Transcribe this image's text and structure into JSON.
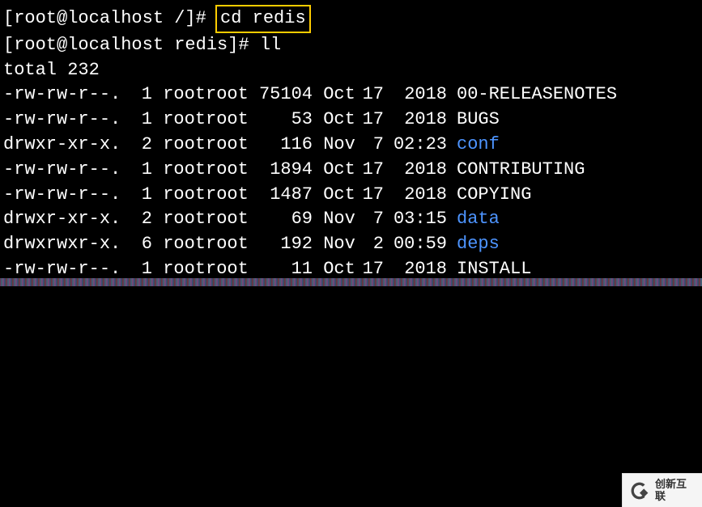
{
  "prompt1": {
    "user_host": "[root@localhost /]# ",
    "command": "cd redis"
  },
  "prompt2": {
    "user_host": "[root@localhost redis]# ",
    "command": "ll"
  },
  "total_line": "total 232",
  "files": [
    {
      "perm": "-rw-rw-r--.",
      "links": "1",
      "owner": "root",
      "group": "root",
      "size": "75104",
      "mon": "Oct",
      "day": "17",
      "time": "2018",
      "name": "00-RELEASENOTES",
      "is_dir": false
    },
    {
      "perm": "-rw-rw-r--.",
      "links": "1",
      "owner": "root",
      "group": "root",
      "size": "53",
      "mon": "Oct",
      "day": "17",
      "time": "2018",
      "name": "BUGS",
      "is_dir": false
    },
    {
      "perm": "drwxr-xr-x.",
      "links": "2",
      "owner": "root",
      "group": "root",
      "size": "116",
      "mon": "Nov",
      "day": "7",
      "time": "02:23",
      "name": "conf",
      "is_dir": true
    },
    {
      "perm": "-rw-rw-r--.",
      "links": "1",
      "owner": "root",
      "group": "root",
      "size": "1894",
      "mon": "Oct",
      "day": "17",
      "time": "2018",
      "name": "CONTRIBUTING",
      "is_dir": false
    },
    {
      "perm": "-rw-rw-r--.",
      "links": "1",
      "owner": "root",
      "group": "root",
      "size": "1487",
      "mon": "Oct",
      "day": "17",
      "time": "2018",
      "name": "COPYING",
      "is_dir": false
    },
    {
      "perm": "drwxr-xr-x.",
      "links": "2",
      "owner": "root",
      "group": "root",
      "size": "69",
      "mon": "Nov",
      "day": "7",
      "time": "03:15",
      "name": "data",
      "is_dir": true
    },
    {
      "perm": "drwxrwxr-x.",
      "links": "6",
      "owner": "root",
      "group": "root",
      "size": "192",
      "mon": "Nov",
      "day": "2",
      "time": "00:59",
      "name": "deps",
      "is_dir": true
    },
    {
      "perm": "-rw-rw-r--.",
      "links": "1",
      "owner": "root",
      "group": "root",
      "size": "11",
      "mon": "Oct",
      "day": "17",
      "time": "2018",
      "name": "INSTALL",
      "is_dir": false
    }
  ],
  "watermark": {
    "text": "创新互联"
  }
}
